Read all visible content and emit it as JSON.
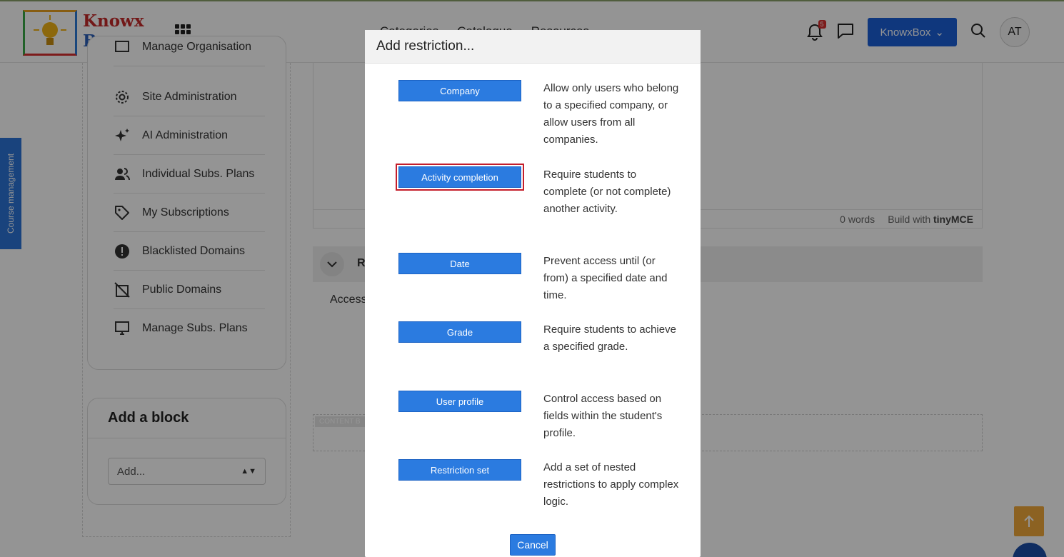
{
  "header": {
    "brand_line1": "Knowx",
    "brand_line2": "Box",
    "nav": [
      "Categories",
      "Catalogue",
      "Resources"
    ],
    "notification_count": "5",
    "user_button_label": "KnowxBox",
    "avatar_initials": "AT"
  },
  "side_tab": {
    "label": "Course management"
  },
  "sidebar": {
    "items": [
      {
        "label": "Manage Organisation",
        "icon": "org-icon"
      },
      {
        "label": "Site Administration",
        "icon": "gear-icon"
      },
      {
        "label": "AI Administration",
        "icon": "sparkle-icon"
      },
      {
        "label": "Individual Subs. Plans",
        "icon": "users-icon"
      },
      {
        "label": "My Subscriptions",
        "icon": "tag-icon"
      },
      {
        "label": "Blacklisted Domains",
        "icon": "alert-icon"
      },
      {
        "label": "Public Domains",
        "icon": "domain-off-icon"
      },
      {
        "label": "Manage Subs. Plans",
        "icon": "monitor-icon"
      }
    ]
  },
  "block": {
    "title": "Add a block",
    "select_value": "Add..."
  },
  "editor": {
    "word_count": "0 words",
    "build_with": "Build with",
    "tinymce": "tinyMCE"
  },
  "section": {
    "letter": "R",
    "access_text": "Access",
    "content_label": "CONTENT B"
  },
  "modal": {
    "title": "Add restriction...",
    "options": [
      {
        "button": "Company",
        "description": "Allow only users who belong to a specified company, or allow users from all companies."
      },
      {
        "button": "Activity completion",
        "description": "Require students to complete (or not complete) another activity."
      },
      {
        "button": "Date",
        "description": "Prevent access until (or from) a specified date and time."
      },
      {
        "button": "Grade",
        "description": "Require students to achieve a specified grade."
      },
      {
        "button": "User profile",
        "description": "Control access based on fields within the student's profile."
      },
      {
        "button": "Restriction set",
        "description": "Add a set of nested restrictions to apply complex logic."
      }
    ],
    "cancel_label": "Cancel"
  },
  "colors": {
    "primary": "#2b7be0",
    "brand_button": "#1a5fd8",
    "focus_outline": "#c41d2a",
    "to_top": "#f2a93b"
  }
}
